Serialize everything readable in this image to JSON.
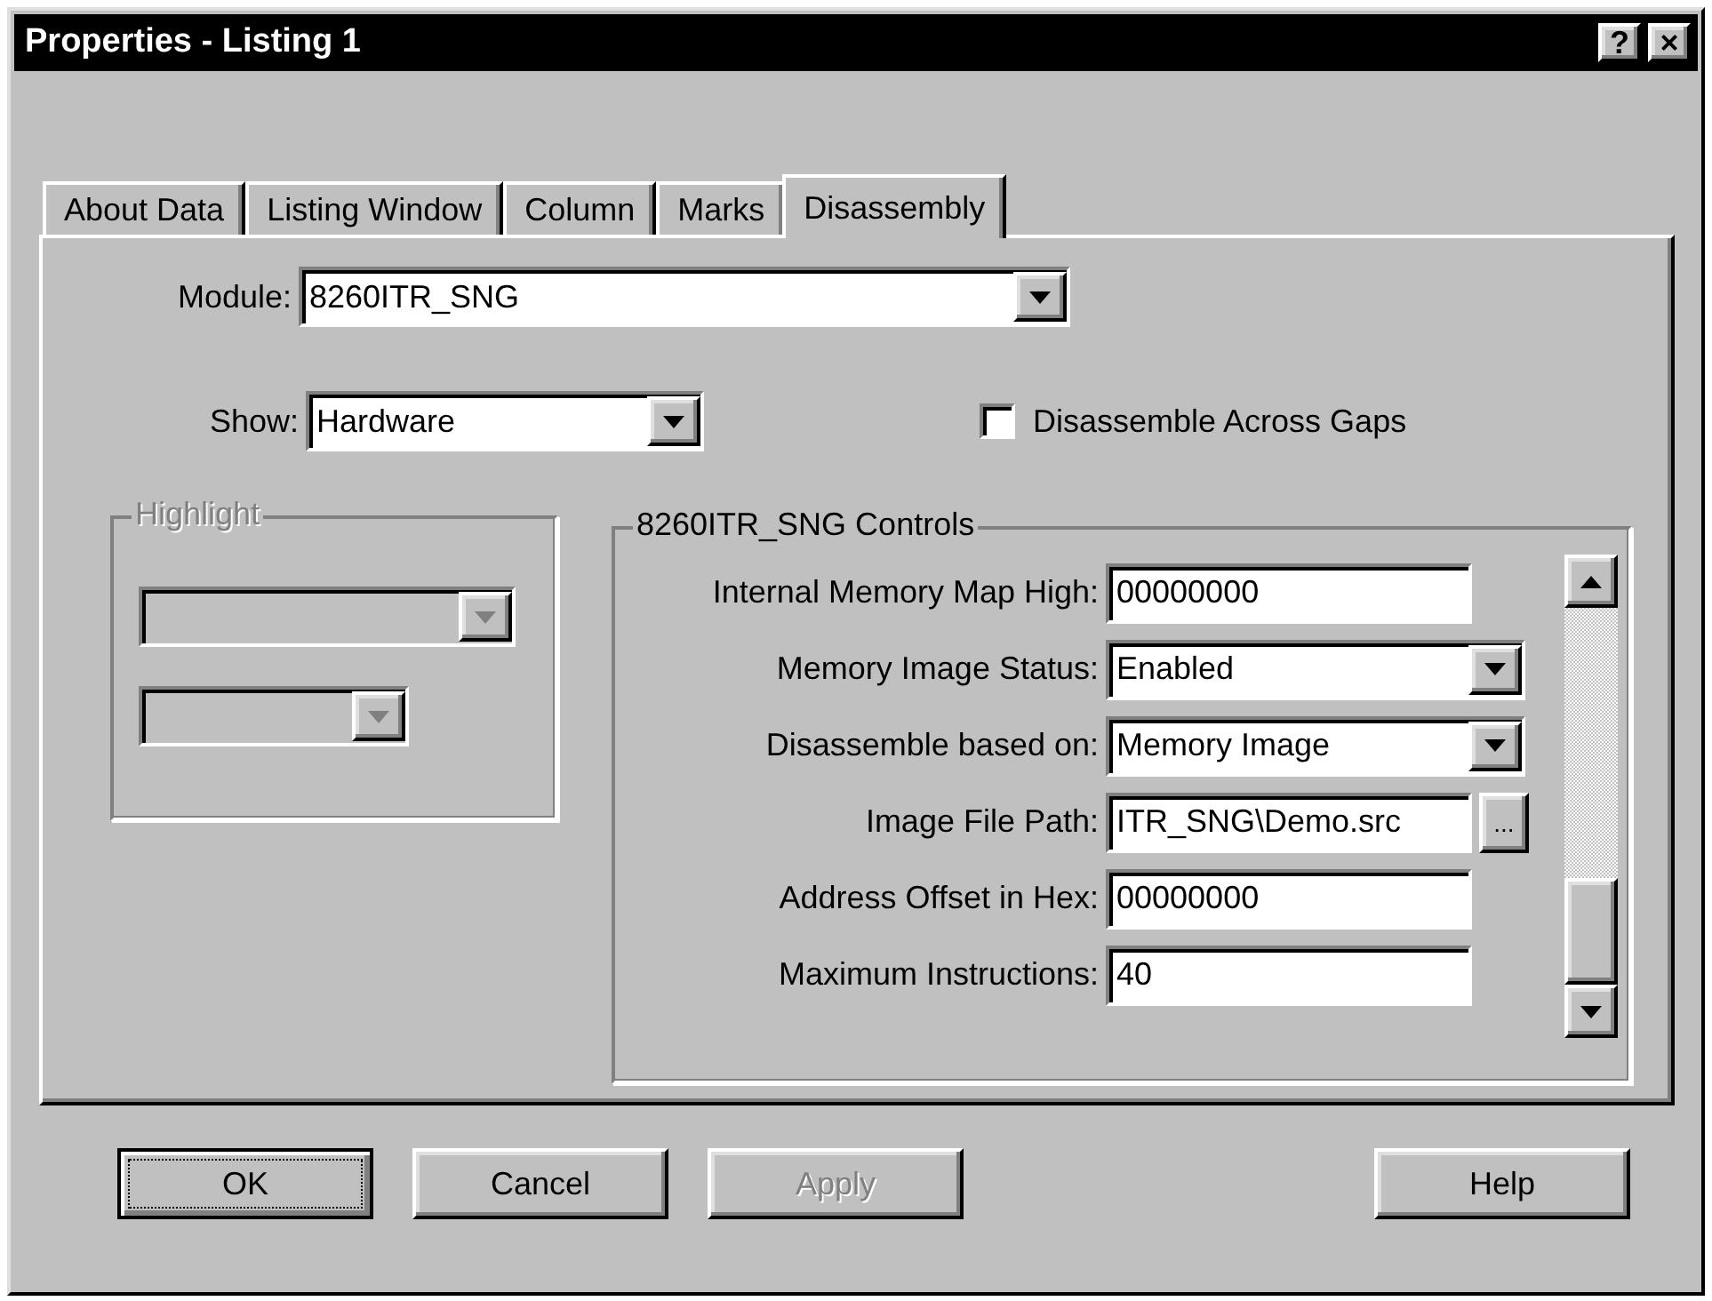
{
  "window": {
    "title": "Properties - Listing 1",
    "help_button": "?",
    "close_button": "×"
  },
  "tabs": [
    {
      "label": "About Data",
      "selected": false
    },
    {
      "label": "Listing Window",
      "selected": false
    },
    {
      "label": "Column",
      "selected": false
    },
    {
      "label": "Marks",
      "selected": false
    },
    {
      "label": "Disassembly",
      "selected": true
    }
  ],
  "module": {
    "label": "Module:",
    "value": "8260ITR_SNG"
  },
  "show": {
    "label": "Show:",
    "value": "Hardware"
  },
  "disassemble_across_gaps": {
    "label": "Disassemble Across Gaps",
    "checked": false
  },
  "highlight": {
    "title": "Highlight",
    "disabled": true
  },
  "controls": {
    "title": "8260ITR_SNG Controls",
    "rows": [
      {
        "kind": "text",
        "label": "Internal Memory Map High:",
        "value": "00000000"
      },
      {
        "kind": "dropdown",
        "label": "Memory Image Status:",
        "value": "Enabled"
      },
      {
        "kind": "dropdown",
        "label": "Disassemble based on:",
        "value": "Memory Image"
      },
      {
        "kind": "browse",
        "label": "Image File Path:",
        "value": "ITR_SNG\\Demo.src",
        "button": "..."
      },
      {
        "kind": "text",
        "label": "Address Offset in Hex:",
        "value": "00000000"
      },
      {
        "kind": "text",
        "label": "Maximum Instructions:",
        "value": "40"
      }
    ]
  },
  "buttons": [
    {
      "label": "OK",
      "focused": true,
      "disabled": false
    },
    {
      "label": "Cancel",
      "focused": false,
      "disabled": false
    },
    {
      "label": "Apply",
      "focused": false,
      "disabled": true
    },
    {
      "label": "Help",
      "focused": false,
      "disabled": false
    }
  ]
}
